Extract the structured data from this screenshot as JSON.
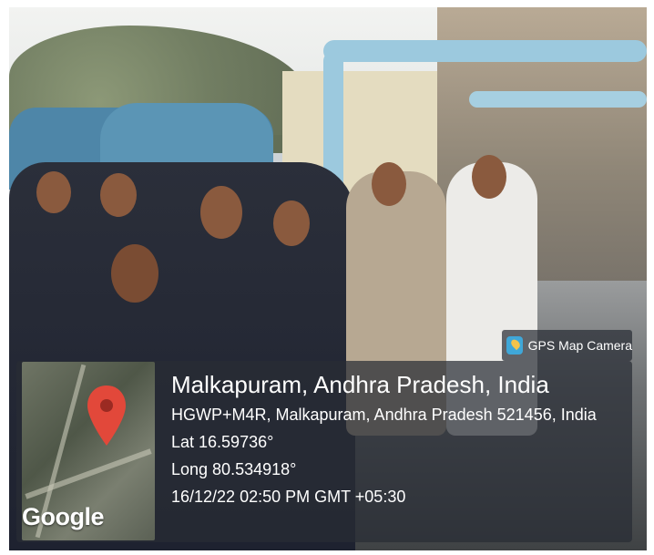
{
  "gps_badge": {
    "label": "GPS Map Camera",
    "icon": "gps-map-camera-icon"
  },
  "location": {
    "title": "Malkapuram, Andhra Pradesh, India",
    "address": "HGWP+M4R, Malkapuram, Andhra Pradesh 521456, India",
    "lat": "Lat 16.59736°",
    "long": "Long 80.534918°",
    "datetime": "16/12/22 02:50 PM GMT +05:30"
  },
  "map": {
    "logo": "Google",
    "pin_icon": "location-pin-icon"
  },
  "colors": {
    "pin": "#e2483a",
    "overlay": "#282c34",
    "pipe": "#9cc9de"
  }
}
